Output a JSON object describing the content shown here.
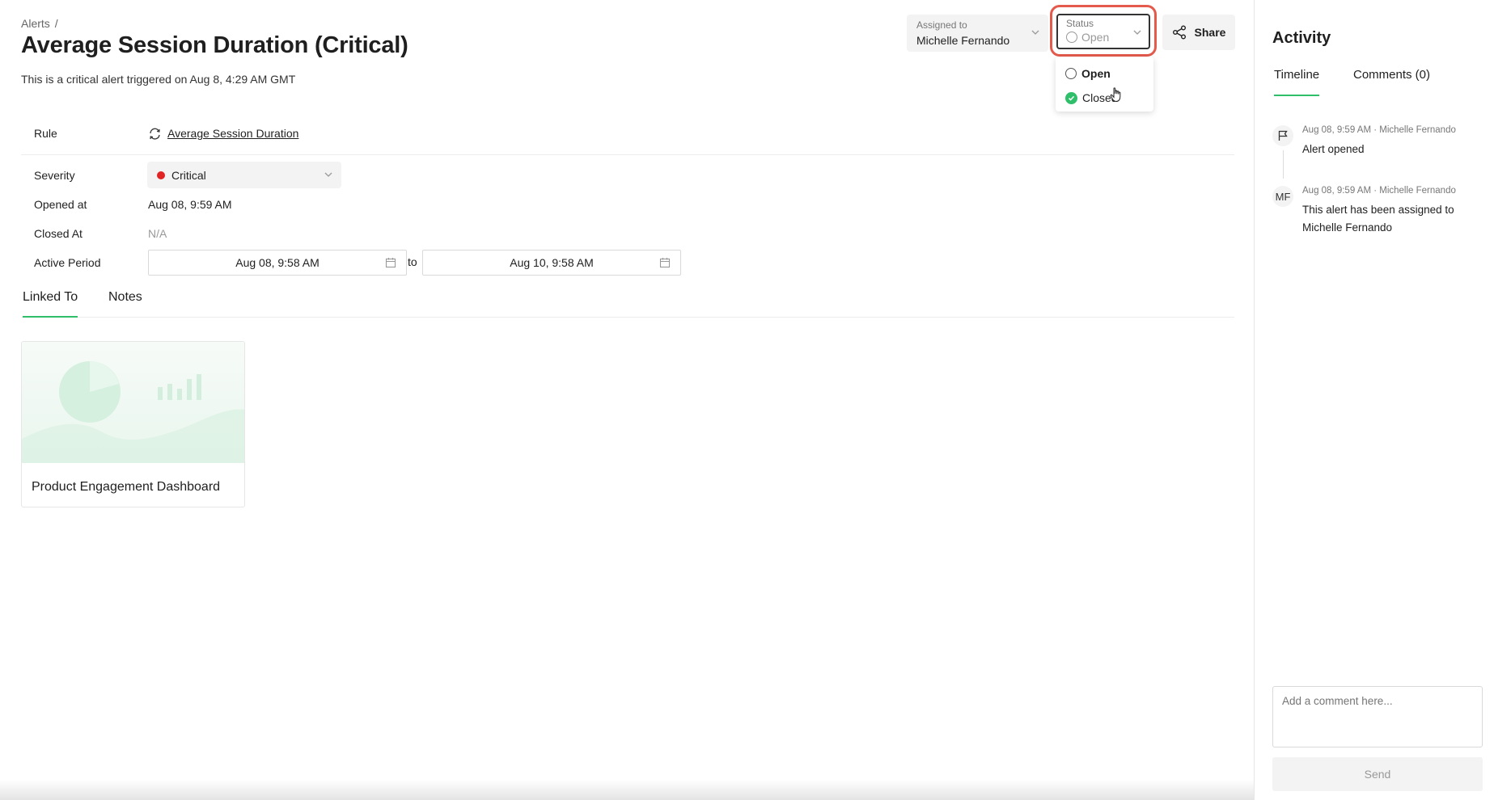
{
  "breadcrumb": {
    "parent": "Alerts",
    "separator": "/"
  },
  "header": {
    "title": "Average Session Duration (Critical)",
    "subtitle": "This is a critical alert triggered on Aug 8, 4:29 AM GMT"
  },
  "assigned": {
    "label": "Assigned to",
    "value": "Michelle Fernando"
  },
  "status": {
    "label": "Status",
    "value": "Open",
    "options": [
      {
        "label": "Open",
        "icon": "empty-circle-icon"
      },
      {
        "label": "Closed",
        "icon": "green-check-circle-icon"
      }
    ]
  },
  "share": {
    "label": "Share"
  },
  "properties": {
    "rule": {
      "label": "Rule",
      "value": "Average Session Duration"
    },
    "severity": {
      "label": "Severity",
      "value": "Critical",
      "color": "#e02424"
    },
    "opened_at": {
      "label": "Opened at",
      "value": "Aug 08, 9:59 AM"
    },
    "closed_at": {
      "label": "Closed At",
      "value": "N/A"
    },
    "active_period": {
      "label": "Active Period",
      "from": "Aug 08, 9:58 AM",
      "to_label": "to",
      "to": "Aug 10, 9:58 AM"
    }
  },
  "tabs": {
    "linked_to": "Linked To",
    "notes": "Notes"
  },
  "linked_card": {
    "title": "Product Engagement Dashboard"
  },
  "activity": {
    "title": "Activity",
    "tabs": {
      "timeline": "Timeline",
      "comments": "Comments (0)"
    },
    "timeline": [
      {
        "meta": "Aug 08, 9:59 AM · Michelle Fernando",
        "text": "Alert opened",
        "icon": "flag-icon"
      },
      {
        "meta": "Aug 08, 9:59 AM · Michelle Fernando",
        "text": "This alert has been assigned to Michelle Fernando",
        "initials": "MF"
      }
    ],
    "comment_placeholder": "Add a comment here...",
    "send_label": "Send"
  },
  "colors": {
    "accent": "#2fbf6a",
    "highlight": "#e45a4c",
    "critical": "#e02424"
  }
}
